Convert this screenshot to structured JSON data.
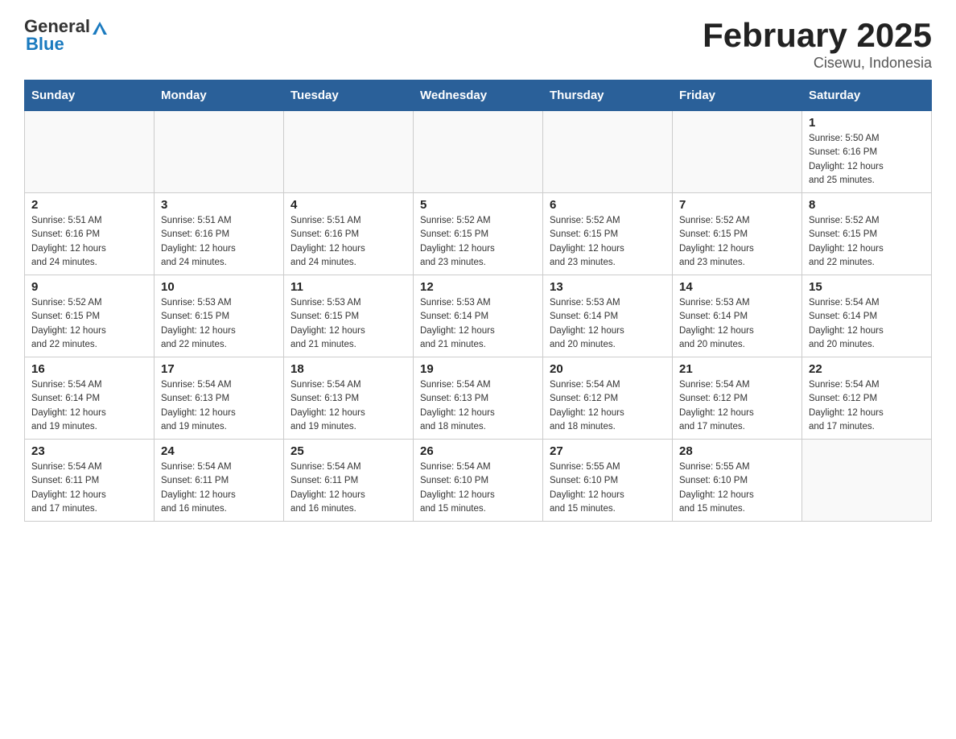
{
  "header": {
    "logo_general": "General",
    "logo_blue": "Blue",
    "title": "February 2025",
    "location": "Cisewu, Indonesia"
  },
  "days_of_week": [
    "Sunday",
    "Monday",
    "Tuesday",
    "Wednesday",
    "Thursday",
    "Friday",
    "Saturday"
  ],
  "weeks": [
    {
      "cells": [
        {
          "day": "",
          "info": ""
        },
        {
          "day": "",
          "info": ""
        },
        {
          "day": "",
          "info": ""
        },
        {
          "day": "",
          "info": ""
        },
        {
          "day": "",
          "info": ""
        },
        {
          "day": "",
          "info": ""
        },
        {
          "day": "1",
          "info": "Sunrise: 5:50 AM\nSunset: 6:16 PM\nDaylight: 12 hours\nand 25 minutes."
        }
      ]
    },
    {
      "cells": [
        {
          "day": "2",
          "info": "Sunrise: 5:51 AM\nSunset: 6:16 PM\nDaylight: 12 hours\nand 24 minutes."
        },
        {
          "day": "3",
          "info": "Sunrise: 5:51 AM\nSunset: 6:16 PM\nDaylight: 12 hours\nand 24 minutes."
        },
        {
          "day": "4",
          "info": "Sunrise: 5:51 AM\nSunset: 6:16 PM\nDaylight: 12 hours\nand 24 minutes."
        },
        {
          "day": "5",
          "info": "Sunrise: 5:52 AM\nSunset: 6:15 PM\nDaylight: 12 hours\nand 23 minutes."
        },
        {
          "day": "6",
          "info": "Sunrise: 5:52 AM\nSunset: 6:15 PM\nDaylight: 12 hours\nand 23 minutes."
        },
        {
          "day": "7",
          "info": "Sunrise: 5:52 AM\nSunset: 6:15 PM\nDaylight: 12 hours\nand 23 minutes."
        },
        {
          "day": "8",
          "info": "Sunrise: 5:52 AM\nSunset: 6:15 PM\nDaylight: 12 hours\nand 22 minutes."
        }
      ]
    },
    {
      "cells": [
        {
          "day": "9",
          "info": "Sunrise: 5:52 AM\nSunset: 6:15 PM\nDaylight: 12 hours\nand 22 minutes."
        },
        {
          "day": "10",
          "info": "Sunrise: 5:53 AM\nSunset: 6:15 PM\nDaylight: 12 hours\nand 22 minutes."
        },
        {
          "day": "11",
          "info": "Sunrise: 5:53 AM\nSunset: 6:15 PM\nDaylight: 12 hours\nand 21 minutes."
        },
        {
          "day": "12",
          "info": "Sunrise: 5:53 AM\nSunset: 6:14 PM\nDaylight: 12 hours\nand 21 minutes."
        },
        {
          "day": "13",
          "info": "Sunrise: 5:53 AM\nSunset: 6:14 PM\nDaylight: 12 hours\nand 20 minutes."
        },
        {
          "day": "14",
          "info": "Sunrise: 5:53 AM\nSunset: 6:14 PM\nDaylight: 12 hours\nand 20 minutes."
        },
        {
          "day": "15",
          "info": "Sunrise: 5:54 AM\nSunset: 6:14 PM\nDaylight: 12 hours\nand 20 minutes."
        }
      ]
    },
    {
      "cells": [
        {
          "day": "16",
          "info": "Sunrise: 5:54 AM\nSunset: 6:14 PM\nDaylight: 12 hours\nand 19 minutes."
        },
        {
          "day": "17",
          "info": "Sunrise: 5:54 AM\nSunset: 6:13 PM\nDaylight: 12 hours\nand 19 minutes."
        },
        {
          "day": "18",
          "info": "Sunrise: 5:54 AM\nSunset: 6:13 PM\nDaylight: 12 hours\nand 19 minutes."
        },
        {
          "day": "19",
          "info": "Sunrise: 5:54 AM\nSunset: 6:13 PM\nDaylight: 12 hours\nand 18 minutes."
        },
        {
          "day": "20",
          "info": "Sunrise: 5:54 AM\nSunset: 6:12 PM\nDaylight: 12 hours\nand 18 minutes."
        },
        {
          "day": "21",
          "info": "Sunrise: 5:54 AM\nSunset: 6:12 PM\nDaylight: 12 hours\nand 17 minutes."
        },
        {
          "day": "22",
          "info": "Sunrise: 5:54 AM\nSunset: 6:12 PM\nDaylight: 12 hours\nand 17 minutes."
        }
      ]
    },
    {
      "cells": [
        {
          "day": "23",
          "info": "Sunrise: 5:54 AM\nSunset: 6:11 PM\nDaylight: 12 hours\nand 17 minutes."
        },
        {
          "day": "24",
          "info": "Sunrise: 5:54 AM\nSunset: 6:11 PM\nDaylight: 12 hours\nand 16 minutes."
        },
        {
          "day": "25",
          "info": "Sunrise: 5:54 AM\nSunset: 6:11 PM\nDaylight: 12 hours\nand 16 minutes."
        },
        {
          "day": "26",
          "info": "Sunrise: 5:54 AM\nSunset: 6:10 PM\nDaylight: 12 hours\nand 15 minutes."
        },
        {
          "day": "27",
          "info": "Sunrise: 5:55 AM\nSunset: 6:10 PM\nDaylight: 12 hours\nand 15 minutes."
        },
        {
          "day": "28",
          "info": "Sunrise: 5:55 AM\nSunset: 6:10 PM\nDaylight: 12 hours\nand 15 minutes."
        },
        {
          "day": "",
          "info": ""
        }
      ]
    }
  ]
}
